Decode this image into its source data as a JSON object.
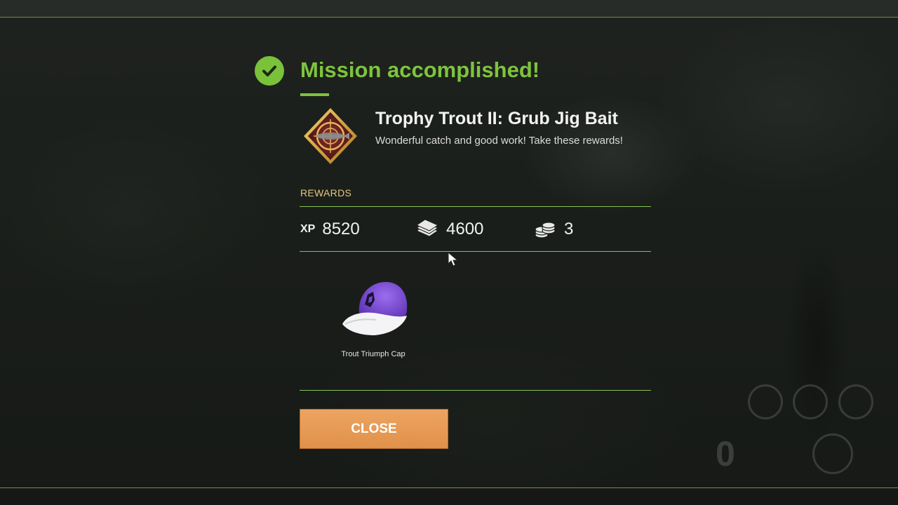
{
  "dialog": {
    "heading": "Mission accomplished!",
    "mission_name": "Trophy Trout II: Grub Jig Bait",
    "mission_description": "Wonderful catch and good work! Take these rewards!",
    "rewards_label": "REWARDS",
    "rewards": {
      "xp_tag": "XP",
      "xp": "8520",
      "money": "4600",
      "coins": "3"
    },
    "item": {
      "name": "Trout Triumph Cap"
    },
    "close_label": "CLOSE"
  },
  "colors": {
    "accent_green": "#7dc43c",
    "rewards_label": "#e8c77a",
    "button_orange": "#e8984f",
    "cap_purple": "#7b4fd6"
  },
  "icons": [
    "check-circle-icon",
    "mission-badge-icon",
    "cash-icon",
    "coins-icon",
    "cap-item-icon",
    "cursor-icon"
  ]
}
